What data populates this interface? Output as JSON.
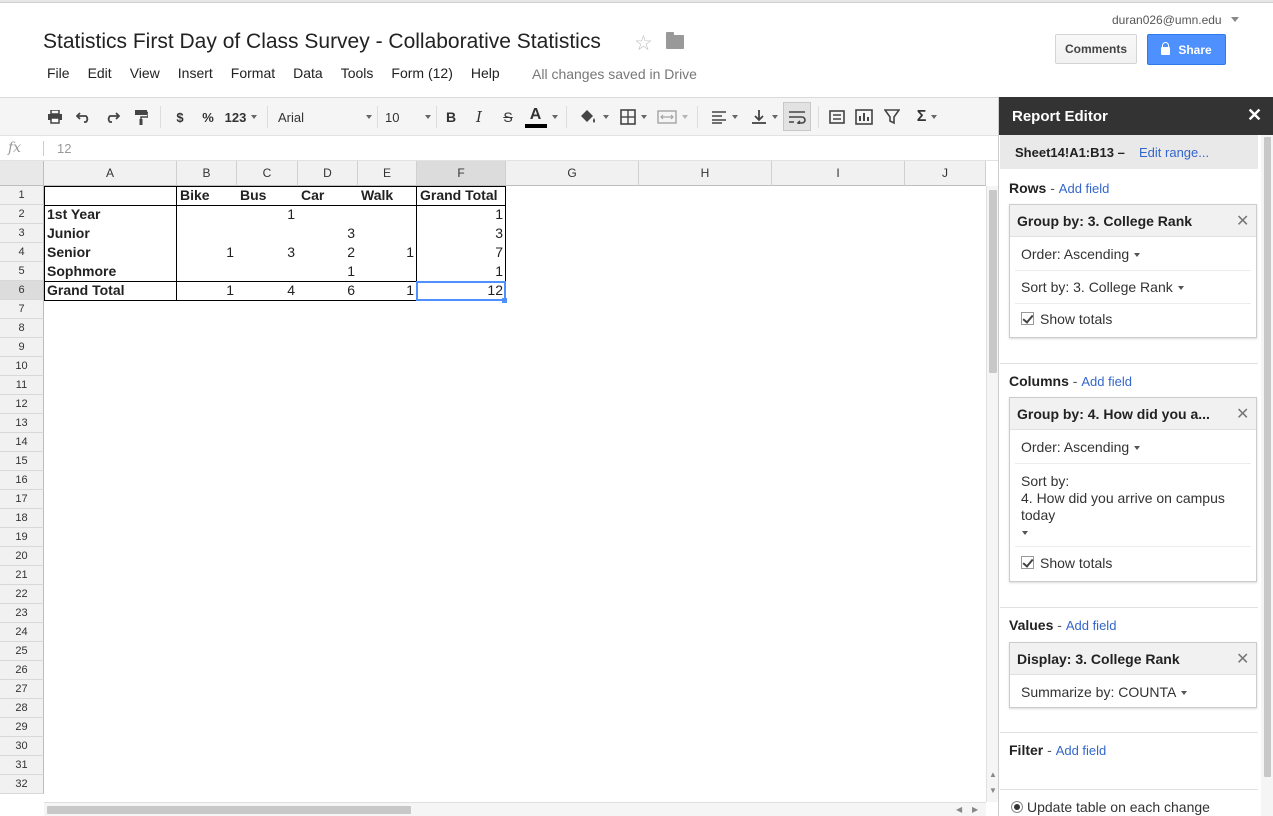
{
  "header": {
    "title": "Statistics First Day of Class Survey - Collaborative Statistics",
    "user_email": "duran026@umn.edu",
    "comments_label": "Comments",
    "share_label": "Share",
    "saved_status": "All changes saved in Drive"
  },
  "menu": {
    "items": [
      "File",
      "Edit",
      "View",
      "Insert",
      "Format",
      "Data",
      "Tools",
      "Form (12)",
      "Help"
    ]
  },
  "toolbar": {
    "currency_label": "$",
    "percent_label": "%",
    "number_format_label": "123",
    "font_name": "Arial",
    "font_size": "10",
    "bold_label": "B",
    "italic_label": "I",
    "strike_label": "S",
    "text_color_label": "A",
    "sum_label": "Σ"
  },
  "formula_bar": {
    "fx_label": "fx",
    "value": "12"
  },
  "grid": {
    "columns": [
      "A",
      "B",
      "C",
      "D",
      "E",
      "F",
      "G",
      "H",
      "I",
      "J"
    ],
    "selected_column": "F",
    "selected_row": "6",
    "rows": [
      "1",
      "2",
      "3",
      "4",
      "5",
      "6",
      "7",
      "8",
      "9",
      "10",
      "11",
      "12",
      "13",
      "14",
      "15",
      "16",
      "17",
      "18",
      "19",
      "20",
      "21",
      "22",
      "23",
      "24",
      "25",
      "26",
      "27",
      "28",
      "29",
      "30",
      "31",
      "32"
    ]
  },
  "pivot": {
    "header": [
      "",
      "Bike",
      "Bus",
      "Car",
      "Walk",
      "Grand Total"
    ],
    "rows": [
      [
        "1st Year",
        "",
        "1",
        "",
        "",
        "1"
      ],
      [
        "Junior",
        "",
        "",
        "3",
        "",
        "3"
      ],
      [
        "Senior",
        "1",
        "3",
        "2",
        "1",
        "7"
      ],
      [
        "Sophmore",
        "",
        "",
        "1",
        "",
        "1"
      ],
      [
        "Grand Total",
        "1",
        "4",
        "6",
        "1",
        "12"
      ]
    ]
  },
  "report_editor": {
    "title": "Report Editor",
    "close_label": "✕",
    "range": "Sheet14!A1:B13 –",
    "edit_range_label": "Edit range...",
    "rows_section": {
      "title": "Rows",
      "separator": "-",
      "add_field": "Add field",
      "card_title": "Group by: 3. College Rank",
      "order": "Order: Ascending",
      "sort_by": "Sort by: 3. College Rank",
      "show_totals": "Show totals"
    },
    "columns_section": {
      "title": "Columns",
      "separator": "-",
      "add_field": "Add field",
      "card_title": "Group by: 4. How did you a...",
      "order": "Order: Ascending",
      "sort_by_label": "Sort by:",
      "sort_by_value_line1": "4. How did you arrive on campus",
      "sort_by_value_line2": "today",
      "show_totals": "Show totals"
    },
    "values_section": {
      "title": "Values",
      "separator": "-",
      "add_field": "Add field",
      "card_title": "Display: 3. College Rank",
      "summarize": "Summarize by: COUNTA"
    },
    "filter_section": {
      "title": "Filter",
      "separator": "-",
      "add_field": "Add field"
    },
    "update_option": "Update table on each change"
  },
  "colors": {
    "accent": "#4d90fe",
    "link": "#3366cc",
    "panel_header": "#333333"
  }
}
